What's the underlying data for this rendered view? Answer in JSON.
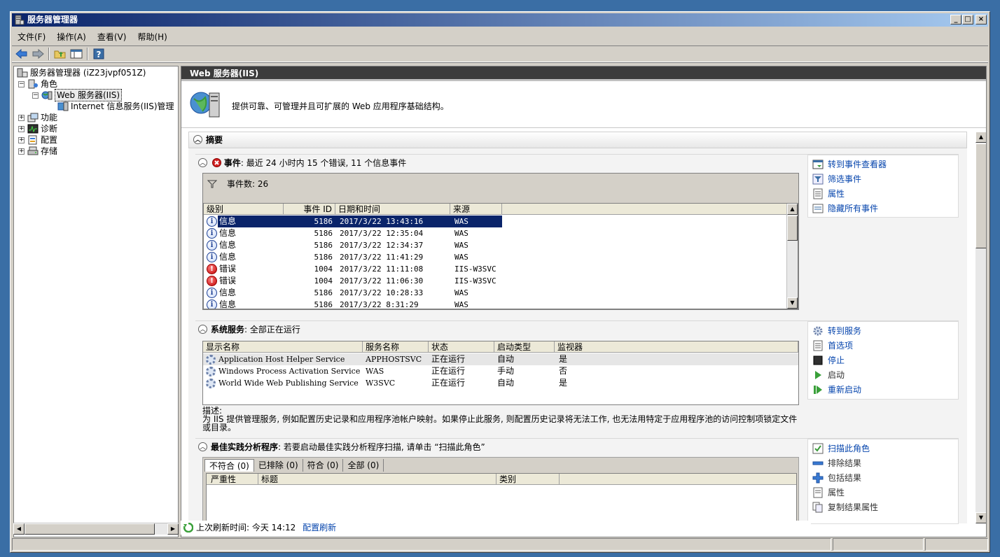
{
  "window": {
    "title": "服务器管理器"
  },
  "menu": [
    "文件(F)",
    "操作(A)",
    "查看(V)",
    "帮助(H)"
  ],
  "tree": {
    "root": "服务器管理器 (iZ23jvpf051Z)",
    "roles": "角色",
    "web": "Web 服务器(IIS)",
    "iis": "Internet 信息服务(IIS)管理",
    "features": "功能",
    "diagnostics": "诊断",
    "config": "配置",
    "storage": "存储"
  },
  "pane": {
    "header": "Web 服务器(IIS)",
    "description": "提供可靠、可管理并且可扩展的 Web 应用程序基础结构。",
    "summary": "摘要"
  },
  "events": {
    "title": "事件",
    "subtitle": ": 最近 24 小时内 15 个错误, 11 个信息事件",
    "count_label": "事件数: 26",
    "columns": [
      "级别",
      "事件 ID",
      "日期和时间",
      "来源"
    ],
    "rows": [
      {
        "level": "信息",
        "type": "info",
        "id": "5186",
        "date": "2017/3/22 13:43:16",
        "source": "WAS"
      },
      {
        "level": "信息",
        "type": "info",
        "id": "5186",
        "date": "2017/3/22 12:35:04",
        "source": "WAS"
      },
      {
        "level": "信息",
        "type": "info",
        "id": "5186",
        "date": "2017/3/22 12:34:37",
        "source": "WAS"
      },
      {
        "level": "信息",
        "type": "info",
        "id": "5186",
        "date": "2017/3/22 11:41:29",
        "source": "WAS"
      },
      {
        "level": "错误",
        "type": "error",
        "id": "1004",
        "date": "2017/3/22 11:11:08",
        "source": "IIS-W3SVC"
      },
      {
        "level": "错误",
        "type": "error",
        "id": "1004",
        "date": "2017/3/22 11:06:30",
        "source": "IIS-W3SVC"
      },
      {
        "level": "信息",
        "type": "info",
        "id": "5186",
        "date": "2017/3/22 10:28:33",
        "source": "WAS"
      },
      {
        "level": "信息",
        "type": "info",
        "id": "5186",
        "date": "2017/3/22 8:31:29",
        "source": "WAS"
      }
    ],
    "actions": [
      "转到事件查看器",
      "筛选事件",
      "属性",
      "隐藏所有事件"
    ]
  },
  "services": {
    "title": "系统服务",
    "subtitle": ": 全部正在运行",
    "columns": [
      "显示名称",
      "服务名称",
      "状态",
      "启动类型",
      "监视器"
    ],
    "rows": [
      {
        "display": "Application Host Helper Service",
        "name": "APPHOSTSVC",
        "status": "正在运行",
        "startup": "自动",
        "monitor": "是"
      },
      {
        "display": "Windows Process Activation Service",
        "name": "WAS",
        "status": "正在运行",
        "startup": "手动",
        "monitor": "否"
      },
      {
        "display": "World Wide Web Publishing Service",
        "name": "W3SVC",
        "status": "正在运行",
        "startup": "自动",
        "monitor": "是"
      }
    ],
    "desc_label": "描述:",
    "desc_text": "为 IIS 提供管理服务, 例如配置历史记录和应用程序池帐户映射。如果停止此服务, 则配置历史记录将无法工作, 也无法用特定于应用程序池的访问控制项锁定文件或目录。",
    "actions": [
      "转到服务",
      "首选项",
      "停止",
      "启动",
      "重新启动"
    ]
  },
  "bpa": {
    "title": "最佳实践分析程序",
    "subtitle": ": 若要启动最佳实践分析程序扫描, 请单击 “扫描此角色”",
    "tabs": [
      "不符合 (0)",
      "已排除 (0)",
      "符合 (0)",
      "全部 (0)"
    ],
    "columns": [
      "严重性",
      "标题",
      "类别"
    ],
    "actions": [
      "扫描此角色",
      "排除结果",
      "包括结果",
      "属性",
      "复制结果属性"
    ]
  },
  "refresh": {
    "label": "上次刷新时间: 今天 14:12",
    "link": "配置刷新"
  }
}
